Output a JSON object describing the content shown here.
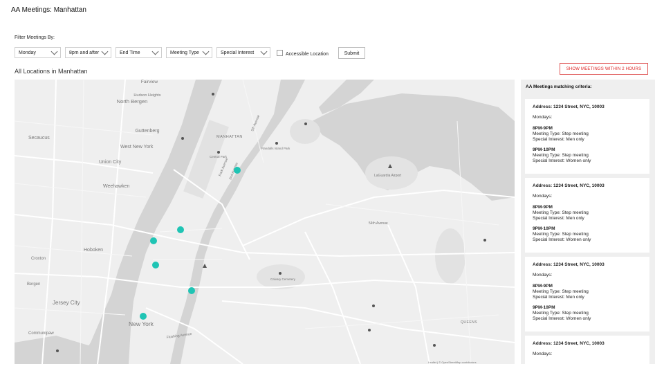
{
  "header": {
    "title": "AA Meetings: Manhattan"
  },
  "filters": {
    "label": "Filter Meetings By:",
    "day": "Monday",
    "start_time": "8pm and after",
    "end_time": "End Time",
    "meeting_type": "Meeting Type",
    "special_interest": "Special Interest",
    "accessible_label": "Accessible Location",
    "submit_label": "Submit"
  },
  "map_section": {
    "title": "All Locations in Manhattan",
    "show_button": "SHOW MEETINGS WITHIN 2 HOURS",
    "labels": {
      "fairview": "Fairview",
      "hudson_heights": "Hudson Heights",
      "north_bergen": "North Bergen",
      "guttenberg": "Guttenberg",
      "secaucus": "Secaucus",
      "west_new_york": "West New York",
      "union_city": "Union City",
      "weehawken": "Weehawken",
      "hoboken": "Hoboken",
      "croxton": "Croxton",
      "bergen": "Bergen",
      "jersey_city": "Jersey City",
      "new_york": "New York",
      "communipaw": "Communipaw",
      "manhattan": "MANHATTAN",
      "queens": "QUEENS",
      "laguardia": "LaGuardia Airport",
      "central_park": "Central Park",
      "randalls": "Randalls Island Park",
      "park_ave": "Park Avenue",
      "second_ave": "2nd Avenue",
      "fifth_ave": "5th Avenue",
      "fifty_fourth": "54th Avenue",
      "flushing_ave": "Flushing Avenue",
      "calvary": "Calvary Cemetery",
      "attribution": "Leaflet | © OpenStreetMap contributors"
    },
    "markers": [
      {
        "name": "meeting-marker-1"
      },
      {
        "name": "meeting-marker-2"
      },
      {
        "name": "meeting-marker-3"
      },
      {
        "name": "meeting-marker-4"
      },
      {
        "name": "meeting-marker-5"
      },
      {
        "name": "meeting-marker-6"
      }
    ],
    "marker_color": "#1fc4b4"
  },
  "results": {
    "title": "AA Meetings matching criteria:",
    "cards": [
      {
        "address": "Address: 1234 Street, NYC, 10003",
        "day": "Mondays:",
        "m1_time": "8PM-9PM",
        "m1_type": "Meeting Type: Step meeting",
        "m1_interest": "Special Interest: Men only",
        "m2_time": "9PM-10PM",
        "m2_type": "Meeting Type: Step meeting",
        "m2_interest": "Special Interest: Women only"
      },
      {
        "address": "Address: 1234 Street, NYC, 10003",
        "day": "Mondays:",
        "m1_time": "8PM-9PM",
        "m1_type": "Meeting Type: Step meeting",
        "m1_interest": "Special Interest: Men only",
        "m2_time": "9PM-10PM",
        "m2_type": "Meeting Type: Step meeting",
        "m2_interest": "Special Interest: Women only"
      },
      {
        "address": "Address: 1234 Street, NYC, 10003",
        "day": "Mondays:",
        "m1_time": "8PM-9PM",
        "m1_type": "Meeting Type: Step meeting",
        "m1_interest": "Special Interest: Men only",
        "m2_time": "9PM-10PM",
        "m2_type": "Meeting Type: Step meeting",
        "m2_interest": "Special Interest: Women only"
      },
      {
        "address": "Address: 1234 Street, NYC, 10003",
        "day": "Mondays:"
      }
    ]
  },
  "colors": {
    "accent_red": "#d22222",
    "water": "#d3d3d3",
    "land": "#efefef"
  }
}
